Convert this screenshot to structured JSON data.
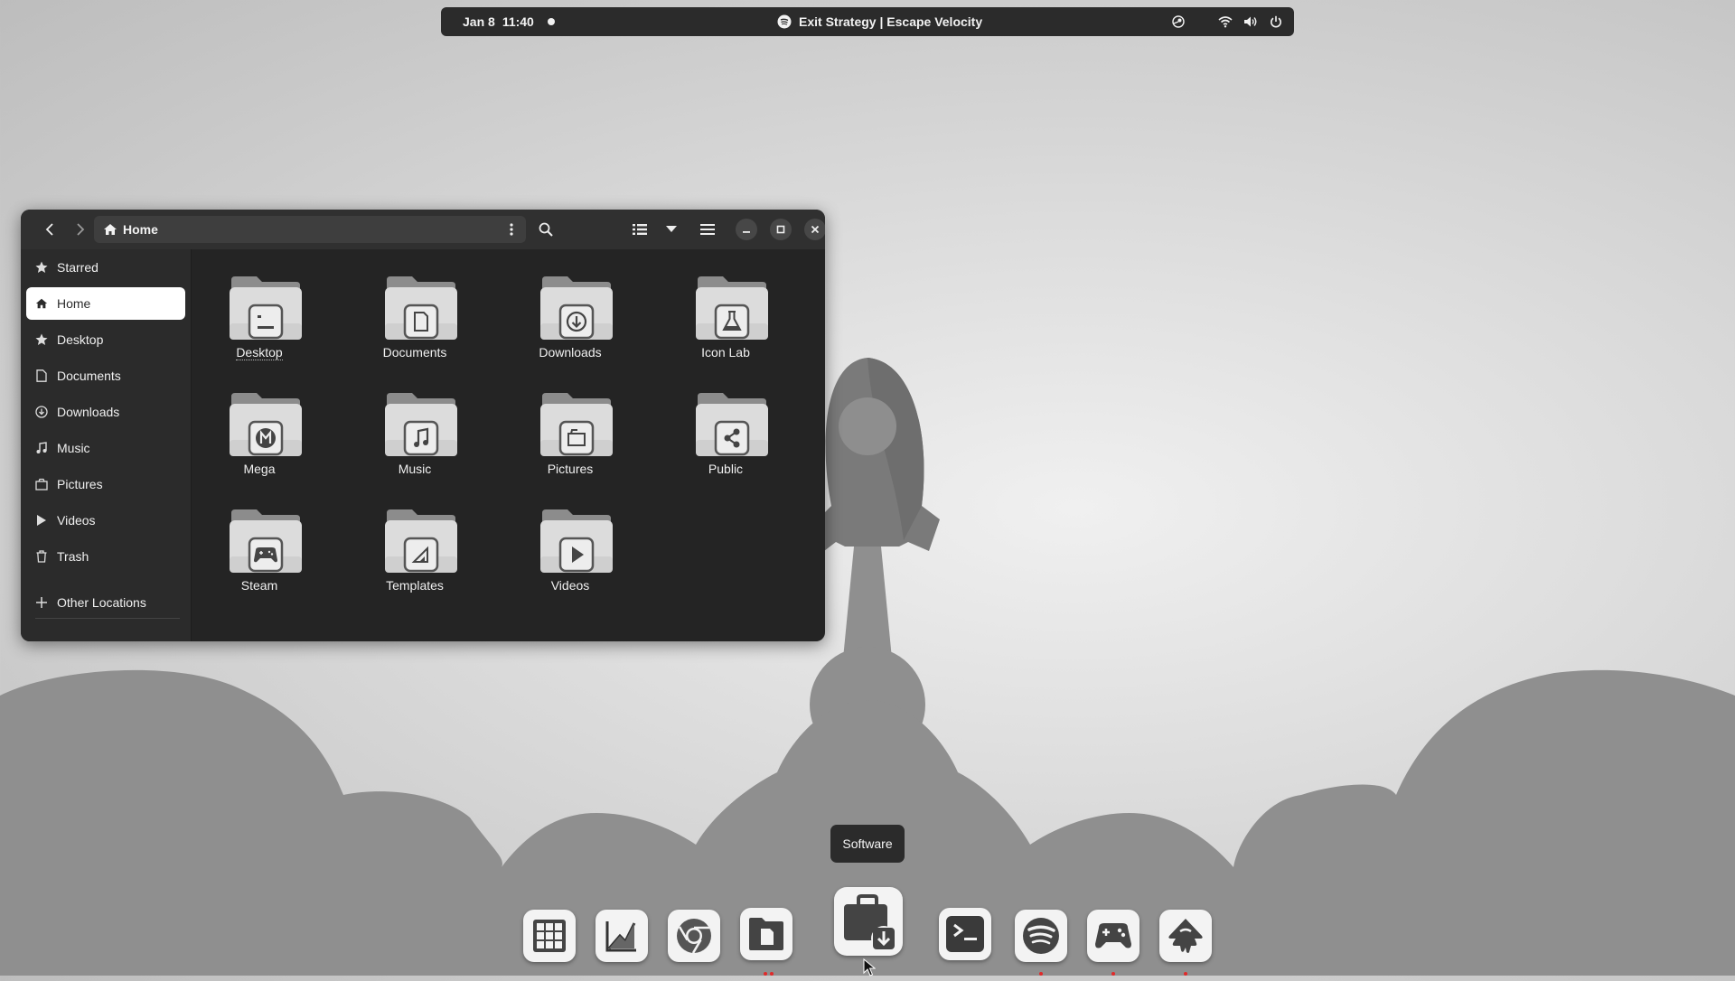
{
  "topbar": {
    "date": "Jan 8",
    "time": "11:40",
    "media": "Exit Strategy | Escape Velocity",
    "icons": [
      "steam-icon",
      "wifi-icon",
      "volume-icon",
      "power-icon"
    ]
  },
  "window": {
    "path": "Home",
    "sidebar": [
      {
        "label": "Starred",
        "icon": "star-icon"
      },
      {
        "label": "Home",
        "icon": "home-icon",
        "active": true
      },
      {
        "label": "Desktop",
        "icon": "desktop-icon"
      },
      {
        "label": "Documents",
        "icon": "document-icon"
      },
      {
        "label": "Downloads",
        "icon": "download-icon"
      },
      {
        "label": "Music",
        "icon": "music-icon"
      },
      {
        "label": "Pictures",
        "icon": "picture-icon"
      },
      {
        "label": "Videos",
        "icon": "video-icon"
      },
      {
        "label": "Trash",
        "icon": "trash-icon"
      },
      {
        "label": "Other Locations",
        "icon": "plus-icon"
      }
    ],
    "folders": [
      {
        "label": "Desktop",
        "emblem": "desktop"
      },
      {
        "label": "Documents",
        "emblem": "document"
      },
      {
        "label": "Downloads",
        "emblem": "download"
      },
      {
        "label": "Icon Lab",
        "emblem": "flask"
      },
      {
        "label": "Mega",
        "emblem": "mega"
      },
      {
        "label": "Music",
        "emblem": "music"
      },
      {
        "label": "Pictures",
        "emblem": "picture"
      },
      {
        "label": "Public",
        "emblem": "share"
      },
      {
        "label": "Steam",
        "emblem": "gamepad"
      },
      {
        "label": "Templates",
        "emblem": "template"
      },
      {
        "label": "Videos",
        "emblem": "play"
      }
    ]
  },
  "tooltip": "Software",
  "dock": {
    "apps": [
      "app-grid-icon",
      "graph-icon",
      "chrome-icon",
      "files-icon",
      "software-icon",
      "terminal-icon",
      "spotify-icon",
      "gamepad-icon",
      "inkscape-icon"
    ]
  },
  "colors": {
    "accent": "#2b2b2b",
    "running_dot": "#e02a2a"
  }
}
